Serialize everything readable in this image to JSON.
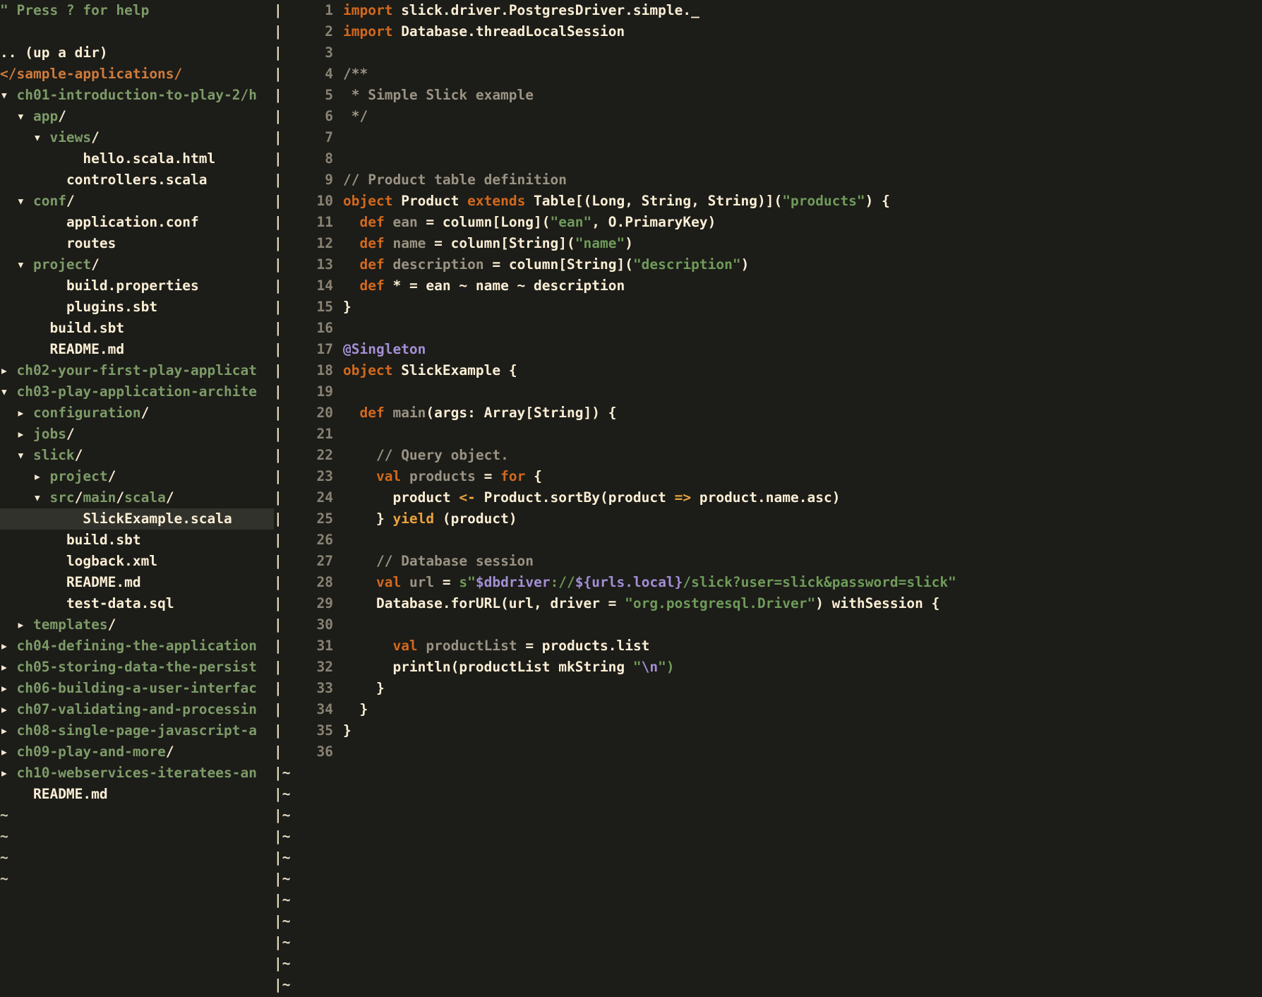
{
  "app": {
    "editor": "vim",
    "colors": {
      "background": "#1c1c18",
      "selection": "#32322c",
      "keyword": "#d2691e",
      "string": "#6f9b5a",
      "comment": "#9a9384",
      "annotation": "#a38fd6",
      "directory": "#7d9b68",
      "file": "#fbeed5",
      "root": "#cf7b3c",
      "linenumber": "#8a8374",
      "operator": "#e8a33d"
    }
  },
  "sidebar": {
    "help_hint": "\" Press ? for help",
    "up_a_dir": ".. (up a dir)",
    "root": "</sample-applications/",
    "selected_item": "SlickExample.scala",
    "items": [
      {
        "indent": 0,
        "arrow": "down",
        "label": "ch01-introduction-to-play-2/h",
        "type": "dir-clipped"
      },
      {
        "indent": 1,
        "arrow": "down",
        "label": "app",
        "type": "dir"
      },
      {
        "indent": 2,
        "arrow": "down",
        "label": "views",
        "type": "dir"
      },
      {
        "indent": 4,
        "arrow": "none",
        "label": "hello.scala.html",
        "type": "file"
      },
      {
        "indent": 3,
        "arrow": "none",
        "label": "controllers.scala",
        "type": "file"
      },
      {
        "indent": 1,
        "arrow": "down",
        "label": "conf",
        "type": "dir"
      },
      {
        "indent": 3,
        "arrow": "none",
        "label": "application.conf",
        "type": "file"
      },
      {
        "indent": 3,
        "arrow": "none",
        "label": "routes",
        "type": "file"
      },
      {
        "indent": 1,
        "arrow": "down",
        "label": "project",
        "type": "dir"
      },
      {
        "indent": 3,
        "arrow": "none",
        "label": "build.properties",
        "type": "file"
      },
      {
        "indent": 3,
        "arrow": "none",
        "label": "plugins.sbt",
        "type": "file"
      },
      {
        "indent": 2,
        "arrow": "none",
        "label": "build.sbt",
        "type": "file"
      },
      {
        "indent": 2,
        "arrow": "none",
        "label": "README.md",
        "type": "file"
      },
      {
        "indent": 0,
        "arrow": "right",
        "label": "ch02-your-first-play-applicat",
        "type": "dir-clipped"
      },
      {
        "indent": 0,
        "arrow": "down",
        "label": "ch03-play-application-archite",
        "type": "dir-clipped"
      },
      {
        "indent": 1,
        "arrow": "right",
        "label": "configuration",
        "type": "dir"
      },
      {
        "indent": 1,
        "arrow": "right",
        "label": "jobs",
        "type": "dir"
      },
      {
        "indent": 1,
        "arrow": "down",
        "label": "slick",
        "type": "dir"
      },
      {
        "indent": 2,
        "arrow": "right",
        "label": "project",
        "type": "dir"
      },
      {
        "indent": 2,
        "arrow": "down",
        "label": "src/main/scala",
        "type": "dir"
      },
      {
        "indent": 4,
        "arrow": "none",
        "label": "SlickExample.scala",
        "type": "file",
        "selected": true
      },
      {
        "indent": 3,
        "arrow": "none",
        "label": "build.sbt",
        "type": "file"
      },
      {
        "indent": 3,
        "arrow": "none",
        "label": "logback.xml",
        "type": "file"
      },
      {
        "indent": 3,
        "arrow": "none",
        "label": "README.md",
        "type": "file"
      },
      {
        "indent": 3,
        "arrow": "none",
        "label": "test-data.sql",
        "type": "file"
      },
      {
        "indent": 1,
        "arrow": "right",
        "label": "templates",
        "type": "dir"
      },
      {
        "indent": 0,
        "arrow": "right",
        "label": "ch04-defining-the-application",
        "type": "dir-clipped"
      },
      {
        "indent": 0,
        "arrow": "right",
        "label": "ch05-storing-data-the-persist",
        "type": "dir-clipped"
      },
      {
        "indent": 0,
        "arrow": "right",
        "label": "ch06-building-a-user-interfac",
        "type": "dir-clipped"
      },
      {
        "indent": 0,
        "arrow": "right",
        "label": "ch07-validating-and-processin",
        "type": "dir-clipped"
      },
      {
        "indent": 0,
        "arrow": "right",
        "label": "ch08-single-page-javascript-a",
        "type": "dir-clipped"
      },
      {
        "indent": 0,
        "arrow": "right",
        "label": "ch09-play-and-more",
        "type": "dir"
      },
      {
        "indent": 0,
        "arrow": "right",
        "label": "ch10-webservices-iteratees-an",
        "type": "dir-clipped"
      },
      {
        "indent": 1,
        "arrow": "none",
        "label": "README.md",
        "type": "file"
      },
      {
        "indent": 0,
        "arrow": "none",
        "label": "~",
        "type": "tilde"
      },
      {
        "indent": 0,
        "arrow": "none",
        "label": "~",
        "type": "tilde"
      },
      {
        "indent": 0,
        "arrow": "none",
        "label": "~",
        "type": "tilde"
      },
      {
        "indent": 0,
        "arrow": "none",
        "label": "~",
        "type": "tilde"
      }
    ]
  },
  "editor": {
    "filename": "SlickExample.scala",
    "language": "scala",
    "first_line": 1,
    "last_line": 36,
    "tilde_rows": 6,
    "lines": [
      {
        "n": 1,
        "tokens": [
          {
            "t": "import",
            "c": "kw"
          },
          {
            "t": " slick.driver.PostgresDriver.simple._",
            "c": "id"
          }
        ]
      },
      {
        "n": 2,
        "tokens": [
          {
            "t": "import",
            "c": "kw"
          },
          {
            "t": " Database.threadLocalSession",
            "c": "id"
          }
        ]
      },
      {
        "n": 3,
        "tokens": []
      },
      {
        "n": 4,
        "tokens": [
          {
            "t": "/**",
            "c": "cmt"
          }
        ]
      },
      {
        "n": 5,
        "tokens": [
          {
            "t": " * Simple Slick example",
            "c": "cmt"
          }
        ]
      },
      {
        "n": 6,
        "tokens": [
          {
            "t": " */",
            "c": "cmt"
          }
        ]
      },
      {
        "n": 7,
        "tokens": []
      },
      {
        "n": 8,
        "tokens": []
      },
      {
        "n": 9,
        "tokens": [
          {
            "t": "// Product table definition",
            "c": "cmt"
          }
        ]
      },
      {
        "n": 10,
        "tokens": [
          {
            "t": "object",
            "c": "kw"
          },
          {
            "t": " Product ",
            "c": "id"
          },
          {
            "t": "extends",
            "c": "kw"
          },
          {
            "t": " Table[(Long, String, String)](",
            "c": "id"
          },
          {
            "t": "\"products\"",
            "c": "str"
          },
          {
            "t": ") {",
            "c": "id"
          }
        ]
      },
      {
        "n": 11,
        "tokens": [
          {
            "t": "  ",
            "c": "plain"
          },
          {
            "t": "def",
            "c": "kw"
          },
          {
            "t": " ean",
            "c": "dim"
          },
          {
            "t": " = column[Long](",
            "c": "id"
          },
          {
            "t": "\"ean\"",
            "c": "str"
          },
          {
            "t": ", O.PrimaryKey)",
            "c": "id"
          }
        ]
      },
      {
        "n": 12,
        "tokens": [
          {
            "t": "  ",
            "c": "plain"
          },
          {
            "t": "def",
            "c": "kw"
          },
          {
            "t": " name",
            "c": "dim"
          },
          {
            "t": " = column[String](",
            "c": "id"
          },
          {
            "t": "\"name\"",
            "c": "str"
          },
          {
            "t": ")",
            "c": "id"
          }
        ]
      },
      {
        "n": 13,
        "tokens": [
          {
            "t": "  ",
            "c": "plain"
          },
          {
            "t": "def",
            "c": "kw"
          },
          {
            "t": " description",
            "c": "dim"
          },
          {
            "t": " = column[String](",
            "c": "id"
          },
          {
            "t": "\"description\"",
            "c": "str"
          },
          {
            "t": ")",
            "c": "id"
          }
        ]
      },
      {
        "n": 14,
        "tokens": [
          {
            "t": "  ",
            "c": "plain"
          },
          {
            "t": "def",
            "c": "kw"
          },
          {
            "t": " * = ean ~ name ~ description",
            "c": "id"
          }
        ]
      },
      {
        "n": 15,
        "tokens": [
          {
            "t": "}",
            "c": "id"
          }
        ]
      },
      {
        "n": 16,
        "tokens": []
      },
      {
        "n": 17,
        "tokens": [
          {
            "t": "@Singleton",
            "c": "anno"
          }
        ]
      },
      {
        "n": 18,
        "tokens": [
          {
            "t": "object",
            "c": "kw"
          },
          {
            "t": " SlickExample {",
            "c": "id"
          }
        ]
      },
      {
        "n": 19,
        "tokens": []
      },
      {
        "n": 20,
        "tokens": [
          {
            "t": "  ",
            "c": "plain"
          },
          {
            "t": "def",
            "c": "kw"
          },
          {
            "t": " main",
            "c": "dim"
          },
          {
            "t": "(args: Array[String]) {",
            "c": "id"
          }
        ]
      },
      {
        "n": 21,
        "tokens": []
      },
      {
        "n": 22,
        "tokens": [
          {
            "t": "    ",
            "c": "plain"
          },
          {
            "t": "// Query object.",
            "c": "cmt"
          }
        ]
      },
      {
        "n": 23,
        "tokens": [
          {
            "t": "    ",
            "c": "plain"
          },
          {
            "t": "val",
            "c": "kw"
          },
          {
            "t": " products",
            "c": "dim"
          },
          {
            "t": " = ",
            "c": "id"
          },
          {
            "t": "for",
            "c": "kw"
          },
          {
            "t": " {",
            "c": "id"
          }
        ]
      },
      {
        "n": 24,
        "tokens": [
          {
            "t": "      product ",
            "c": "id"
          },
          {
            "t": "<-",
            "c": "op"
          },
          {
            "t": " Product.sortBy(product ",
            "c": "id"
          },
          {
            "t": "=>",
            "c": "op"
          },
          {
            "t": " product.name.asc)",
            "c": "id"
          }
        ]
      },
      {
        "n": 25,
        "tokens": [
          {
            "t": "    } ",
            "c": "id"
          },
          {
            "t": "yield",
            "c": "kw2"
          },
          {
            "t": " (product)",
            "c": "id"
          }
        ]
      },
      {
        "n": 26,
        "tokens": []
      },
      {
        "n": 27,
        "tokens": [
          {
            "t": "    ",
            "c": "plain"
          },
          {
            "t": "// Database session",
            "c": "cmt"
          }
        ]
      },
      {
        "n": 28,
        "tokens": [
          {
            "t": "    ",
            "c": "plain"
          },
          {
            "t": "val",
            "c": "kw"
          },
          {
            "t": " url",
            "c": "dim"
          },
          {
            "t": " = ",
            "c": "id"
          },
          {
            "t": "s\"",
            "c": "str"
          },
          {
            "t": "$dbdriver",
            "c": "anno"
          },
          {
            "t": "://",
            "c": "str"
          },
          {
            "t": "${urls.local}",
            "c": "anno"
          },
          {
            "t": "/slick?user=slick&password=slick\"",
            "c": "str"
          }
        ]
      },
      {
        "n": 29,
        "tokens": [
          {
            "t": "    Database.forURL(url, driver = ",
            "c": "id"
          },
          {
            "t": "\"org.postgresql.Driver\"",
            "c": "str"
          },
          {
            "t": ") withSession {",
            "c": "id"
          }
        ]
      },
      {
        "n": 30,
        "tokens": []
      },
      {
        "n": 31,
        "tokens": [
          {
            "t": "      ",
            "c": "plain"
          },
          {
            "t": "val",
            "c": "kw"
          },
          {
            "t": " productList",
            "c": "dim"
          },
          {
            "t": " = products.list",
            "c": "id"
          }
        ]
      },
      {
        "n": 32,
        "tokens": [
          {
            "t": "      println(productList mkString ",
            "c": "id"
          },
          {
            "t": "\"",
            "c": "str"
          },
          {
            "t": "\\n",
            "c": "anno"
          },
          {
            "t": "\")",
            "c": "str"
          }
        ]
      },
      {
        "n": 33,
        "tokens": [
          {
            "t": "    }",
            "c": "id"
          }
        ]
      },
      {
        "n": 34,
        "tokens": [
          {
            "t": "  }",
            "c": "id"
          }
        ]
      },
      {
        "n": 35,
        "tokens": [
          {
            "t": "}",
            "c": "id"
          }
        ]
      },
      {
        "n": 36,
        "tokens": []
      }
    ]
  }
}
